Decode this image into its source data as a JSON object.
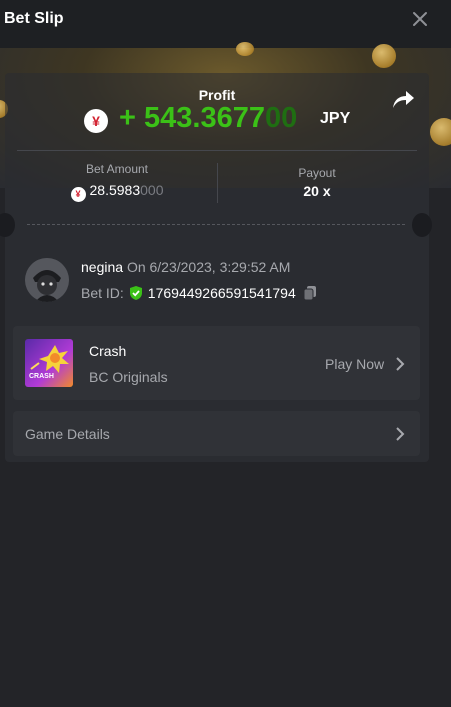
{
  "header": {
    "title": "Bet Slip"
  },
  "profit": {
    "label": "Profit",
    "currency_symbol": "¥",
    "sign": "+",
    "amount_main": "543.3677",
    "amount_trail": "00",
    "currency": "JPY"
  },
  "bet": {
    "amount_label": "Bet Amount",
    "currency_symbol": "¥",
    "amount_main": "28.5983",
    "amount_trail": "000",
    "payout_label": "Payout",
    "payout_value": "20 x"
  },
  "user": {
    "name": "negina",
    "timestamp": "On 6/23/2023, 3:29:52 AM",
    "bet_id_label": "Bet ID:",
    "bet_id": "1769449266591541794"
  },
  "game": {
    "name": "Crash",
    "provider": "BC Originals",
    "thumb_text": "CRASH",
    "play_label": "Play Now"
  },
  "details": {
    "label": "Game Details"
  },
  "colors": {
    "profit_green": "#3bc117",
    "background": "#232428",
    "card": "#2a2c31"
  }
}
